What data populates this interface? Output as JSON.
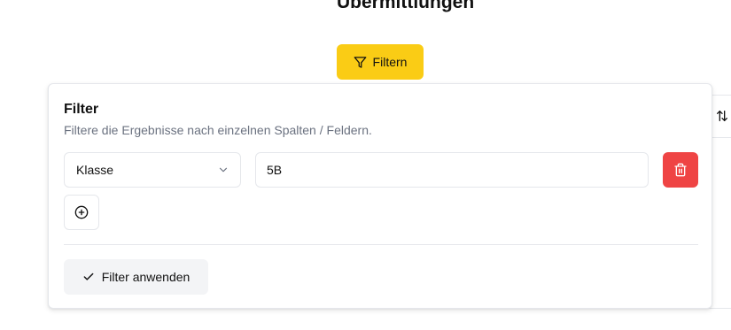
{
  "page": {
    "heading": "Übermittlungen"
  },
  "toolbar": {
    "filter_button_label": "Filtern",
    "filter_button_color": "#facc15"
  },
  "filter_panel": {
    "title": "Filter",
    "description": "Filtere die Ergebnisse nach einzelnen Spalten / Feldern.",
    "rows": [
      {
        "column": "Klasse",
        "value": "5B"
      }
    ],
    "apply_label": "Filter anwenden",
    "delete_button_color": "#ef4444"
  },
  "icons": {
    "filter_button": "filter-icon",
    "column_select": "chevron-down-icon",
    "delete": "trash-icon",
    "add": "plus-circle-icon",
    "apply": "check-icon",
    "table_sort": "sort-arrows-icon"
  }
}
